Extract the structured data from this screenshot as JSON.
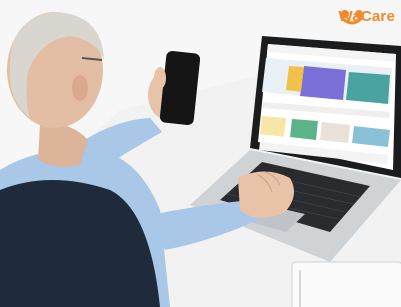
{
  "brand": {
    "name": "WaCare",
    "color": "#f08a2a"
  },
  "scene": {
    "background": "#ffffff",
    "desk": "#f3f3f3",
    "shirt": "#a9c7e6",
    "vest": "#1f2b3c",
    "skin": "#e8c3a8",
    "hair": "#d9d6d0",
    "laptop_body": "#d6d9dc",
    "laptop_screen_frame": "#1b1c1e",
    "phone": "#151515"
  }
}
